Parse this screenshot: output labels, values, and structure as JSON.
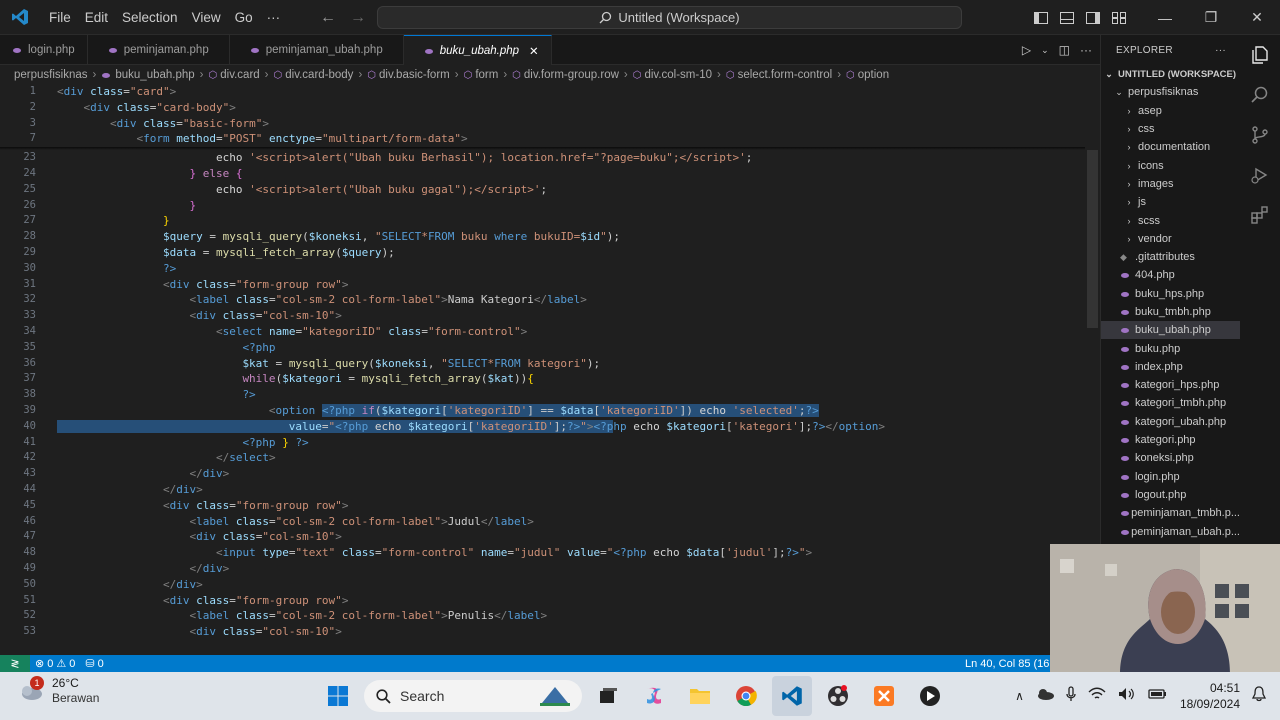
{
  "menu": {
    "items": [
      "File",
      "Edit",
      "Selection",
      "View",
      "Go"
    ],
    "more": "···",
    "search_text": "Untitled (Workspace)"
  },
  "tabs": [
    {
      "label": "login.php",
      "active": false
    },
    {
      "label": "peminjaman.php",
      "active": false
    },
    {
      "label": "peminjaman_ubah.php",
      "active": false
    },
    {
      "label": "buku_ubah.php",
      "active": true
    }
  ],
  "breadcrumb": [
    "perpusfisiknas",
    "buku_ubah.php",
    "div.card",
    "div.card-body",
    "div.basic-form",
    "form",
    "div.form-group.row",
    "div.col-sm-10",
    "select.form-control",
    "option"
  ],
  "explorer": {
    "title": "EXPLORER",
    "workspace": "UNTITLED (WORKSPACE)",
    "root": "perpusfisiknas",
    "folders": [
      "asep",
      "css",
      "documentation",
      "icons",
      "images",
      "js",
      "scss",
      "vendor"
    ],
    "files": [
      ".gitattributes",
      "404.php",
      "buku_hps.php",
      "buku_tmbh.php",
      "buku_ubah.php",
      "buku.php",
      "index.php",
      "kategori_hps.php",
      "kategori_tmbh.php",
      "kategori_ubah.php",
      "kategori.php",
      "koneksi.php",
      "login.php",
      "logout.php",
      "peminjaman_tmbh.p...",
      "peminjaman_ubah.p..."
    ],
    "active_file": "buku_ubah.php"
  },
  "editor": {
    "lines": [
      {
        "n": "1",
        "html": "<span class='p'>&lt;</span><span class='t'>div</span> <span class='a'>class</span>=<span class='s'>\"card\"</span><span class='p'>&gt;</span>",
        "indent": 0
      },
      {
        "n": "2",
        "html": "    <span class='p'>&lt;</span><span class='t'>div</span> <span class='a'>class</span>=<span class='s'>\"card-body\"</span><span class='p'>&gt;</span>",
        "indent": 0
      },
      {
        "n": "3",
        "html": "        <span class='p'>&lt;</span><span class='t'>div</span> <span class='a'>class</span>=<span class='s'>\"basic-form\"</span><span class='p'>&gt;</span>",
        "indent": 0
      },
      {
        "n": "7",
        "html": "            <span class='p'>&lt;</span><span class='t'>form</span> <span class='a'>method</span>=<span class='s'>\"POST\"</span> <span class='a'>enctype</span>=<span class='s'>\"multipart/form-data\"</span><span class='p'>&gt;</span>",
        "indent": 0
      },
      {
        "n": "23",
        "html": "                        <span class='txt'>echo</span> <span class='s'>'&lt;script&gt;alert(\"Ubah buku Berhasil\"); location.href=\"?page=buku\";&lt;/script&gt;'</span>;",
        "indent": 0
      },
      {
        "n": "24",
        "html": "                    <span class='br2'>}</span> <span class='k'>else</span> <span class='br2'>{</span>",
        "indent": 0
      },
      {
        "n": "25",
        "html": "                        <span class='txt'>echo</span> <span class='s'>'&lt;script&gt;alert(\"Ubah buku gagal\");&lt;/script&gt;'</span>;",
        "indent": 0
      },
      {
        "n": "26",
        "html": "                    <span class='br2'>}</span>",
        "indent": 0
      },
      {
        "n": "27",
        "html": "                <span class='br'>}</span>",
        "indent": 0
      },
      {
        "n": "28",
        "html": "                <span class='v'>$query</span> = <span class='f'>mysqli_query</span>(<span class='v'>$koneksi</span>, <span class='s'>\"</span><span class='t'>SELECT</span><span class='s'>*</span><span class='t'>FROM</span><span class='s'> buku </span><span class='t'>where</span><span class='s'> bukuID=</span><span class='v'>$id</span><span class='s'>\"</span>);",
        "indent": 0
      },
      {
        "n": "29",
        "html": "                <span class='v'>$data</span> = <span class='f'>mysqli_fetch_array</span>(<span class='v'>$query</span>);",
        "indent": 0
      },
      {
        "n": "30",
        "html": "                <span class='ph'>?&gt;</span>",
        "indent": 0
      },
      {
        "n": "31",
        "html": "                <span class='p'>&lt;</span><span class='t'>div</span> <span class='a'>class</span>=<span class='s'>\"form-group row\"</span><span class='p'>&gt;</span>",
        "indent": 0
      },
      {
        "n": "32",
        "html": "                    <span class='p'>&lt;</span><span class='t'>label</span> <span class='a'>class</span>=<span class='s'>\"col-sm-2 col-form-label\"</span><span class='p'>&gt;</span>Nama Kategori<span class='p'>&lt;/</span><span class='t'>label</span><span class='p'>&gt;</span>",
        "indent": 0
      },
      {
        "n": "33",
        "html": "                    <span class='p'>&lt;</span><span class='t'>div</span> <span class='a'>class</span>=<span class='s'>\"col-sm-10\"</span><span class='p'>&gt;</span>",
        "indent": 0
      },
      {
        "n": "34",
        "html": "                        <span class='p'>&lt;</span><span class='t'>select</span> <span class='a'>name</span>=<span class='s'>\"kategoriID\"</span> <span class='a'>class</span>=<span class='s'>\"form-control\"</span><span class='p'>&gt;</span>",
        "indent": 0
      },
      {
        "n": "35",
        "html": "                            <span class='ph'>&lt;?php</span>",
        "indent": 0
      },
      {
        "n": "36",
        "html": "                            <span class='v'>$kat</span> = <span class='f'>mysqli_query</span>(<span class='v'>$koneksi</span>, <span class='s'>\"</span><span class='t'>SELECT</span><span class='s'>*</span><span class='t'>FROM</span><span class='s'> kategori\"</span>);",
        "indent": 0
      },
      {
        "n": "37",
        "html": "                            <span class='k'>while</span>(<span class='v'>$kategori</span> = <span class='f'>mysqli_fetch_array</span>(<span class='v'>$kat</span>))<span class='br'>{</span>",
        "indent": 0
      },
      {
        "n": "38",
        "html": "                            <span class='ph'>?&gt;</span>",
        "indent": 0
      },
      {
        "n": "39",
        "html": "                                <span class='p'>&lt;</span><span class='t'>option</span> <span class='sel'><span class='ph'>&lt;?php</span> <span class='k'>if</span>(<span class='v'>$kategori</span>[<span class='s'>'kategoriID'</span>] == <span class='v'>$data</span>[<span class='s'>'kategoriID'</span>]) <span class='txt'>echo</span> <span class='s'>'selected'</span>;<span class='ph'>?&gt;</span></span>",
        "indent": 0
      },
      {
        "n": "40",
        "html": "<span class='sel'>                                   <span class='a'>value</span>=<span class='s'>\"</span><span class='ph'>&lt;?php</span> <span class='txt'>echo</span> <span class='v'>$kategori</span>[<span class='s'>'kategoriID'</span>];<span class='ph'>?&gt;</span><span class='s'>\"</span><span class='p'>&gt;</span><span class='ph'>&lt;?p</span></span><span class='ph'>hp</span> <span class='txt'>echo</span> <span class='v'>$kategori</span>[<span class='s'>'kategori'</span>];<span class='ph'>?&gt;</span><span class='p'>&lt;/</span><span class='t'>option</span><span class='p'>&gt;</span>",
        "indent": 0
      },
      {
        "n": "41",
        "html": "                            <span class='ph'>&lt;?php</span> <span class='br'>}</span> <span class='ph'>?&gt;</span>",
        "indent": 0
      },
      {
        "n": "42",
        "html": "                        <span class='p'>&lt;/</span><span class='t'>select</span><span class='p'>&gt;</span>",
        "indent": 0
      },
      {
        "n": "43",
        "html": "                    <span class='p'>&lt;/</span><span class='t'>div</span><span class='p'>&gt;</span>",
        "indent": 0
      },
      {
        "n": "44",
        "html": "                <span class='p'>&lt;/</span><span class='t'>div</span><span class='p'>&gt;</span>",
        "indent": 0
      },
      {
        "n": "45",
        "html": "                <span class='p'>&lt;</span><span class='t'>div</span> <span class='a'>class</span>=<span class='s'>\"form-group row\"</span><span class='p'>&gt;</span>",
        "indent": 0
      },
      {
        "n": "46",
        "html": "                    <span class='p'>&lt;</span><span class='t'>label</span> <span class='a'>class</span>=<span class='s'>\"col-sm-2 col-form-label\"</span><span class='p'>&gt;</span>Judul<span class='p'>&lt;/</span><span class='t'>label</span><span class='p'>&gt;</span>",
        "indent": 0
      },
      {
        "n": "47",
        "html": "                    <span class='p'>&lt;</span><span class='t'>div</span> <span class='a'>class</span>=<span class='s'>\"col-sm-10\"</span><span class='p'>&gt;</span>",
        "indent": 0
      },
      {
        "n": "48",
        "html": "                        <span class='p'>&lt;</span><span class='t'>input</span> <span class='a'>type</span>=<span class='s'>\"text\"</span> <span class='a'>class</span>=<span class='s'>\"form-control\"</span> <span class='a'>name</span>=<span class='s'>\"judul\"</span> <span class='a'>value</span>=<span class='s'>\"</span><span class='ph'>&lt;?php</span> <span class='txt'>echo</span> <span class='v'>$data</span>[<span class='s'>'judul'</span>];<span class='ph'>?&gt;</span><span class='s'>\"</span><span class='p'>&gt;</span>",
        "indent": 0
      },
      {
        "n": "49",
        "html": "                    <span class='p'>&lt;/</span><span class='t'>div</span><span class='p'>&gt;</span>",
        "indent": 0
      },
      {
        "n": "50",
        "html": "                <span class='p'>&lt;/</span><span class='t'>div</span><span class='p'>&gt;</span>",
        "indent": 0
      },
      {
        "n": "51",
        "html": "                <span class='p'>&lt;</span><span class='t'>div</span> <span class='a'>class</span>=<span class='s'>\"form-group row\"</span><span class='p'>&gt;</span>",
        "indent": 0
      },
      {
        "n": "52",
        "html": "                    <span class='p'>&lt;</span><span class='t'>label</span> <span class='a'>class</span>=<span class='s'>\"col-sm-2 col-form-label\"</span><span class='p'>&gt;</span>Penulis<span class='p'>&lt;/</span><span class='t'>label</span><span class='p'>&gt;</span>",
        "indent": 0
      },
      {
        "n": "53",
        "html": "                    <span class='p'>&lt;</span><span class='t'>div</span> <span class='a'>class</span>=<span class='s'>\"col-sm-10\"</span><span class='p'>&gt;</span>",
        "indent": 0
      }
    ]
  },
  "status": {
    "errors": "0",
    "warnings": "0",
    "ports": "0",
    "position": "Ln 40, Col 85 (161 se"
  },
  "taskbar": {
    "weather_temp": "26°C",
    "weather_desc": "Berawan",
    "weather_badge": "1",
    "search_label": "Search",
    "time": "04:51",
    "date": "18/09/2024"
  }
}
